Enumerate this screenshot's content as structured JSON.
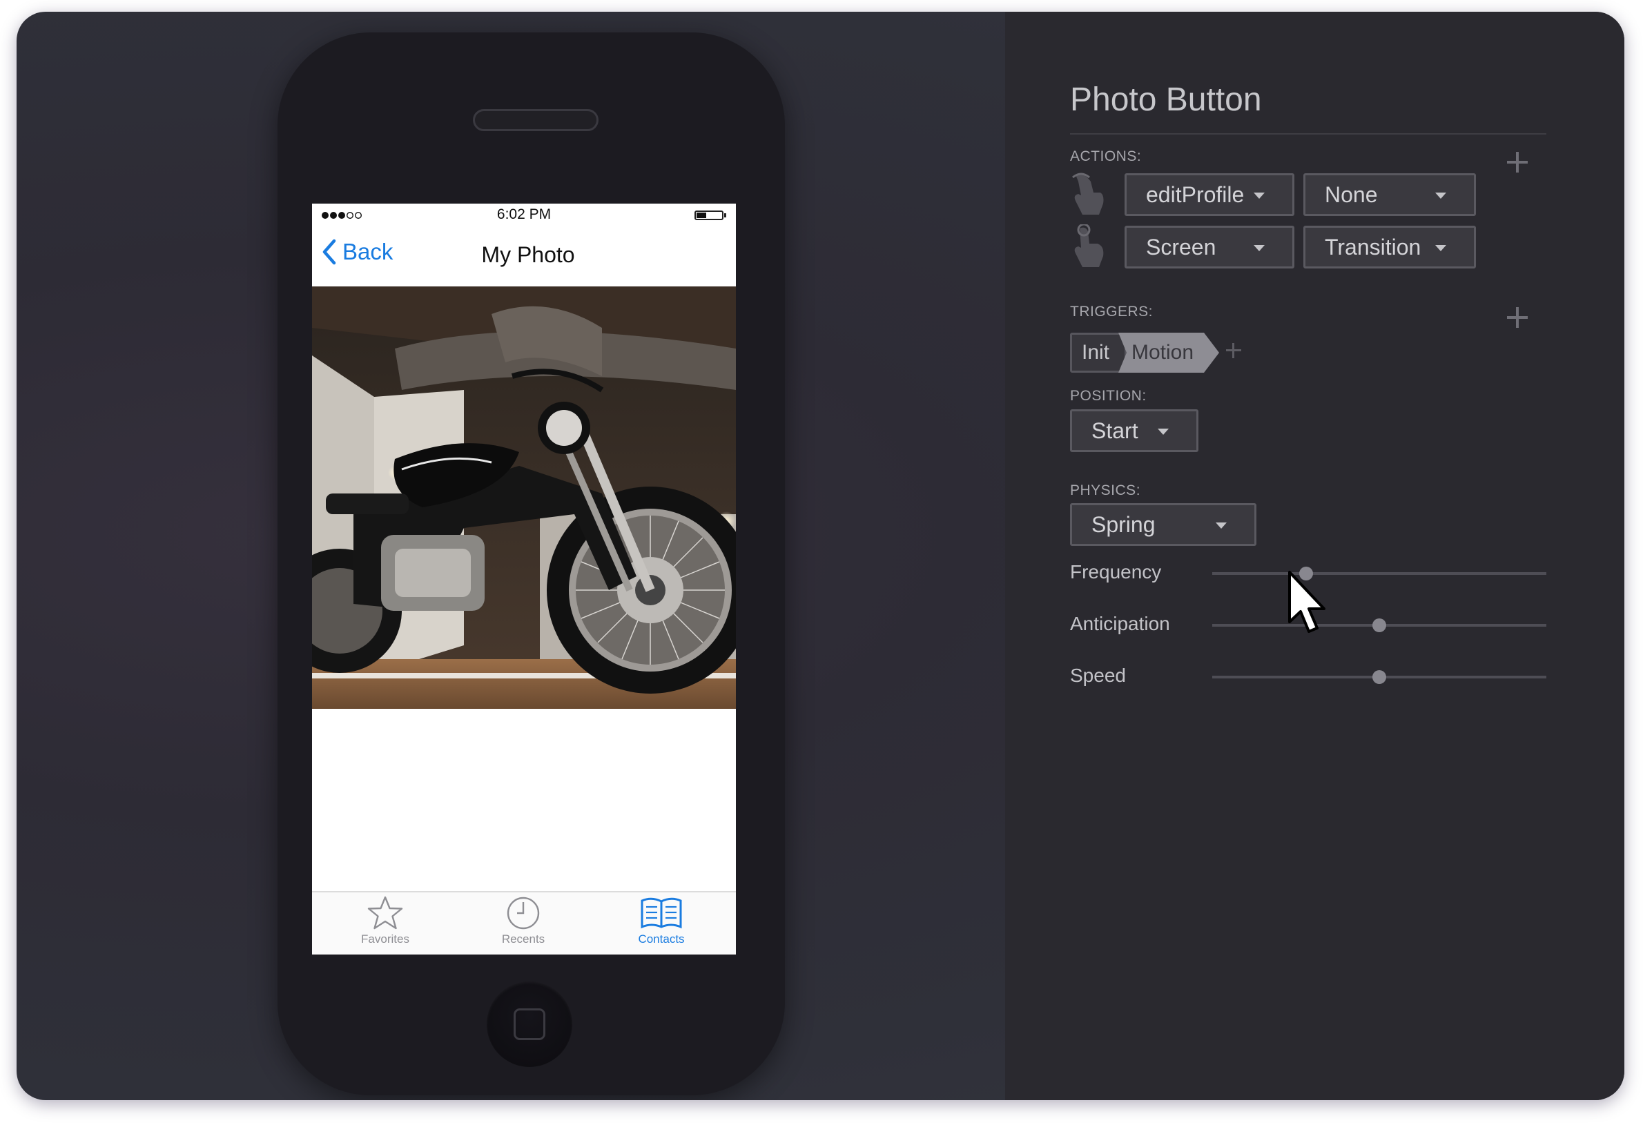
{
  "phone": {
    "status": {
      "time": "6:02 PM"
    },
    "nav": {
      "back_label": "Back",
      "title": "My Photo"
    },
    "tabs": [
      {
        "label": "Favorites",
        "icon": "star-icon",
        "active": false
      },
      {
        "label": "Recents",
        "icon": "clock-icon",
        "active": false
      },
      {
        "label": "Contacts",
        "icon": "book-icon",
        "active": true
      }
    ],
    "colors": {
      "ios_blue": "#1a7ce0",
      "inactive_tab": "#8e8e93"
    }
  },
  "inspector": {
    "title": "Photo Button",
    "actions": {
      "label": "ACTIONS:",
      "rows": [
        {
          "icon": "tap-hand-icon",
          "first": "editProfile",
          "second": "None"
        },
        {
          "icon": "press-hand-icon",
          "first": "Screen",
          "second": "Transition"
        }
      ]
    },
    "triggers": {
      "label": "TRIGGERS:",
      "items": [
        "Init",
        "Motion"
      ]
    },
    "position": {
      "label": "POSITION:",
      "value": "Start"
    },
    "physics": {
      "label": "PHYSICS:",
      "value": "Spring",
      "sliders": [
        {
          "label": "Frequency",
          "value": 0.28
        },
        {
          "label": "Anticipation",
          "value": 0.5
        },
        {
          "label": "Speed",
          "value": 0.5
        }
      ]
    }
  }
}
